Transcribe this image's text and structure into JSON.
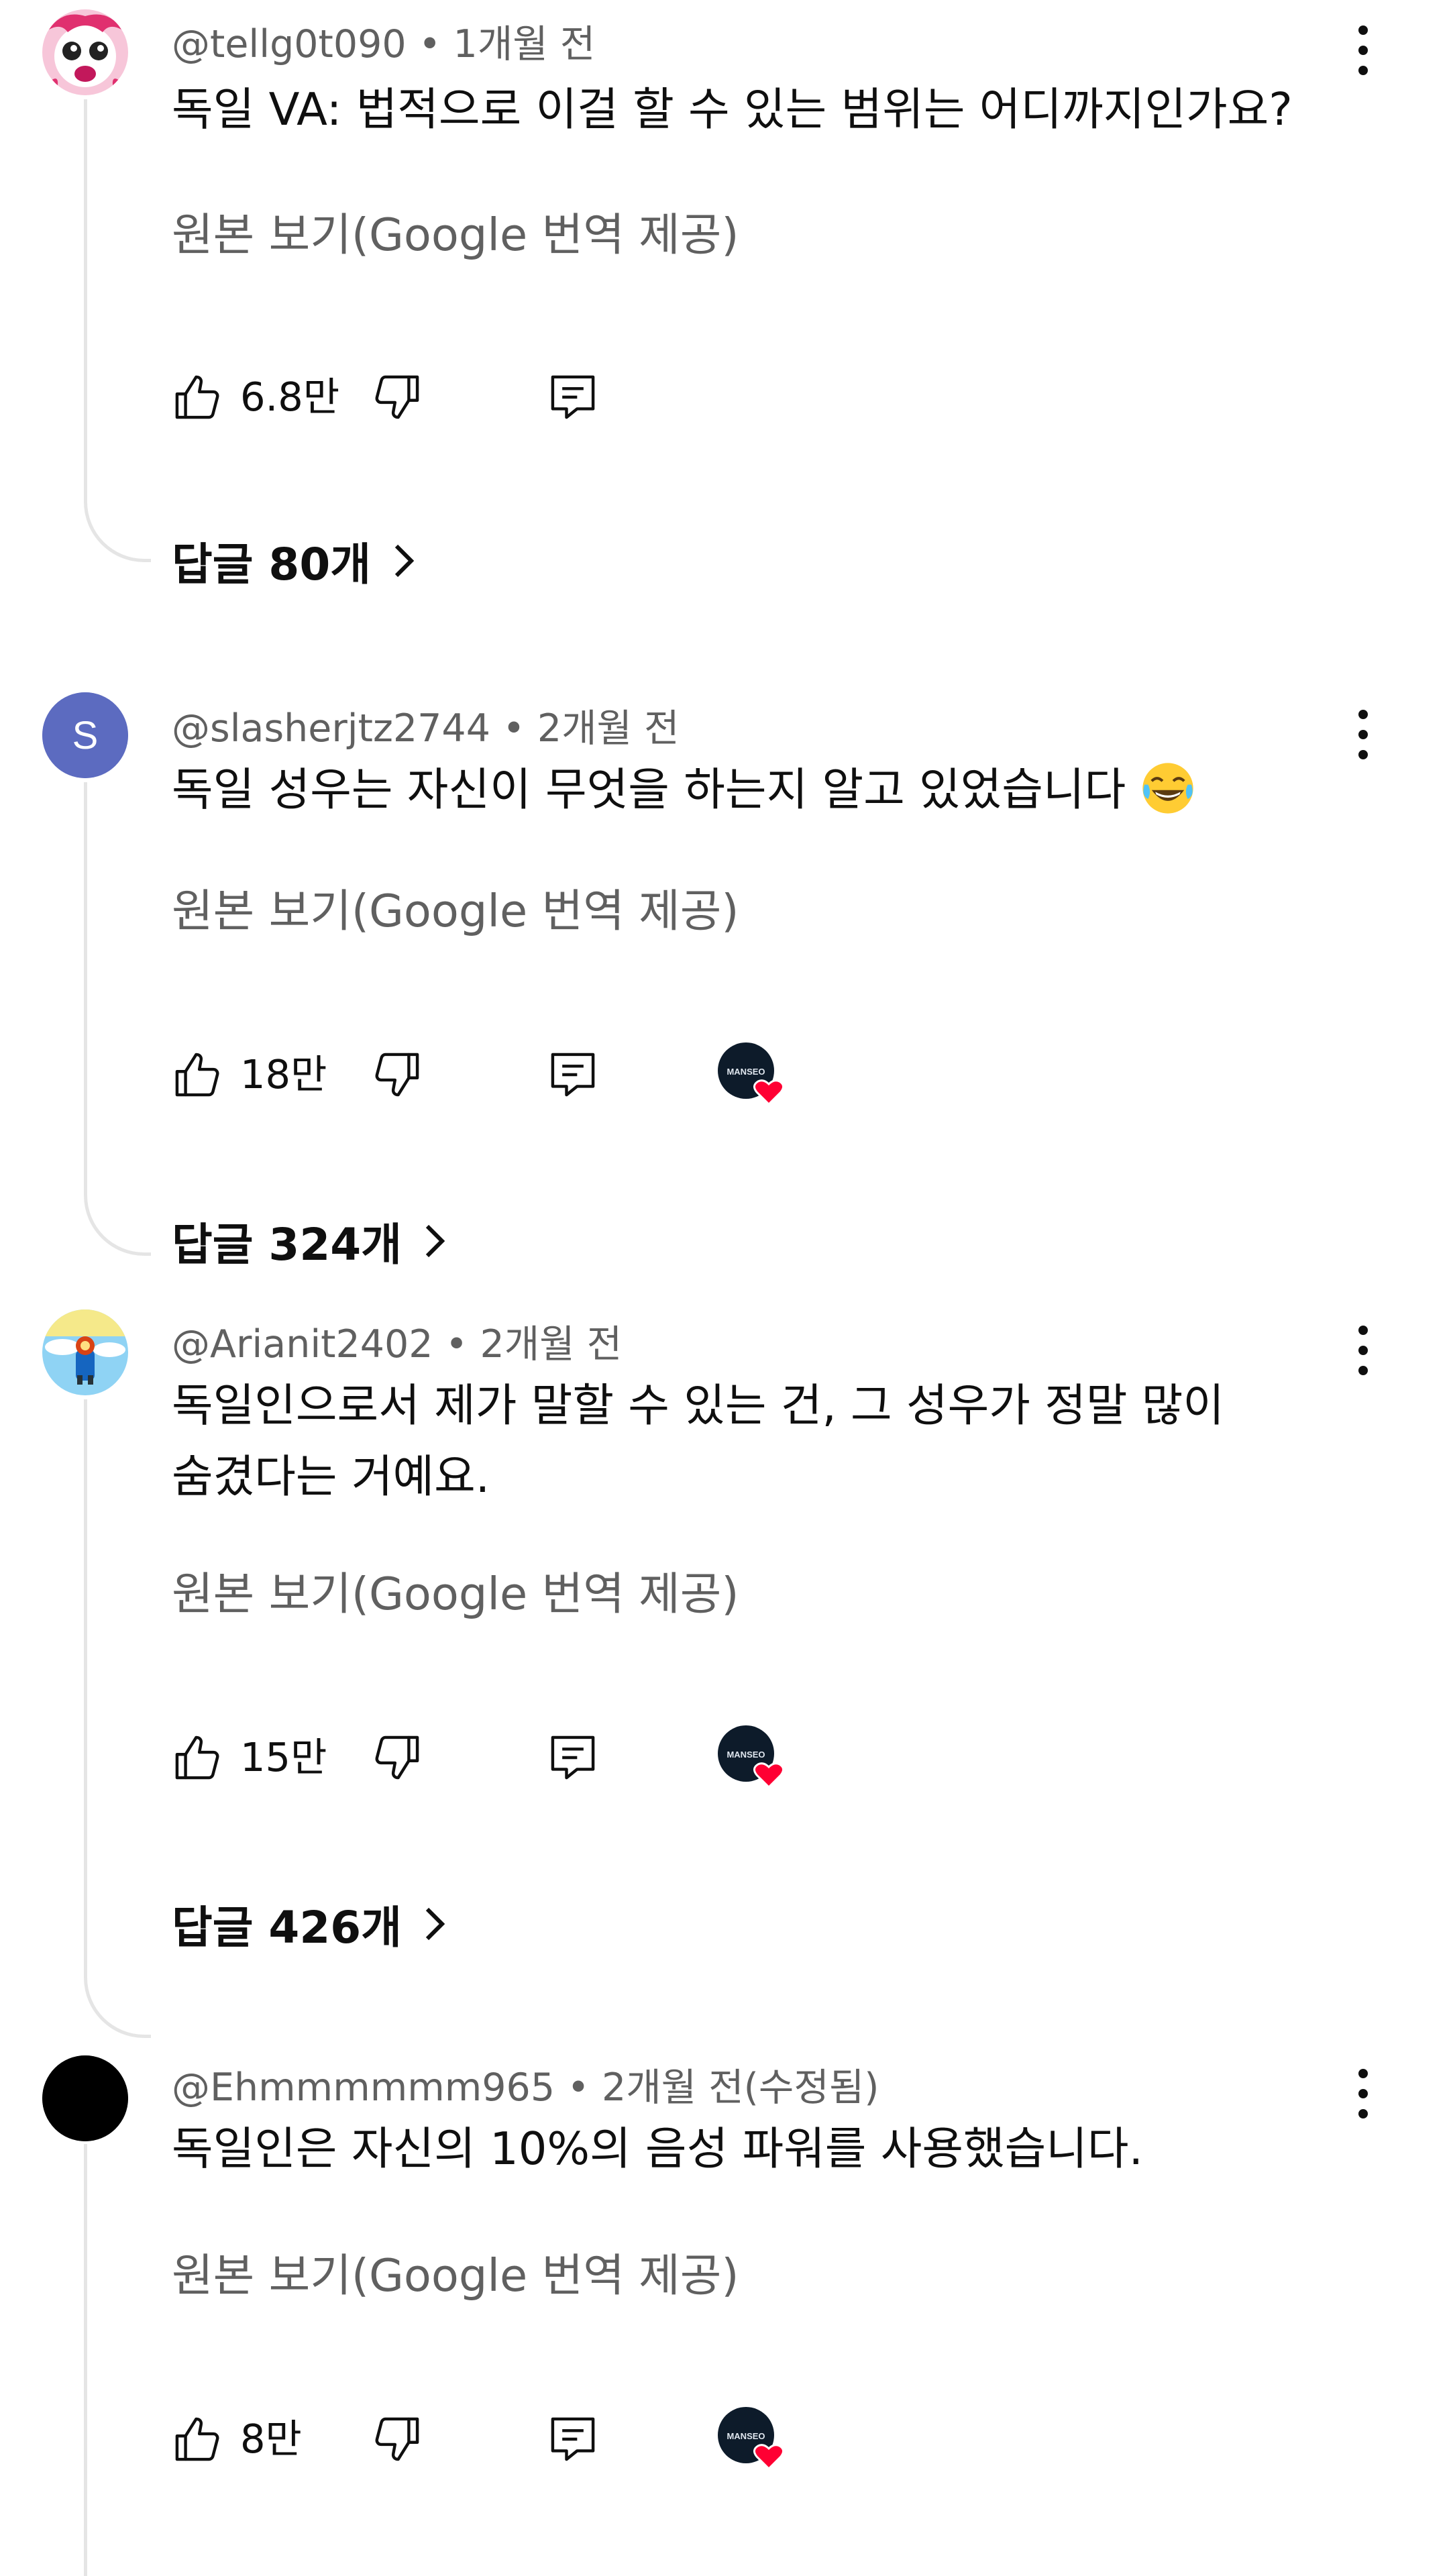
{
  "comments": [
    {
      "handle": "@tellg0t090",
      "time": "• 1개월 전",
      "text": "독일 VA: 법적으로 이걸 할 수 있는 범위는 어디까지인가요?",
      "translate_label": "원본 보기(Google 번역 제공)",
      "likes": "6.8만",
      "replies_label": "답글 80개",
      "creator_hearted": false,
      "avatar_icon": "pink-cartoon-avatar"
    },
    {
      "handle": "@slasherjtz2744",
      "time": "• 2개월 전",
      "text": "독일 성우는 자신이 무엇을 하는지 알고 있었습니다",
      "emoji": "laughing-tears-emoji",
      "translate_label": "원본 보기(Google 번역 제공)",
      "likes": "18만",
      "replies_label": "답글 324개",
      "creator_hearted": true,
      "avatar_letter": "S",
      "avatar_color": "#5c6bc0"
    },
    {
      "handle": "@Arianit2402",
      "time": "• 2개월 전",
      "text_line1": "독일인으로서 제가 말할 수 있는 건, 그 성우가 정말 많이",
      "text_line2": "숨겼다는 거예요.",
      "translate_label": "원본 보기(Google 번역 제공)",
      "likes": "15만",
      "replies_label": "답글 426개",
      "creator_hearted": true,
      "avatar_icon": "sky-character-avatar"
    },
    {
      "handle": "@Ehmmmmmm965",
      "time": "• 2개월 전(수정됨)",
      "text": "독일인은 자신의 10%의 음성 파워를 사용했습니다.",
      "translate_label": "원본 보기(Google 번역 제공)",
      "likes": "8만",
      "creator_hearted": true,
      "avatar_color": "#000000"
    }
  ],
  "creator_badge_text": "MANSEO",
  "colors": {
    "text_primary": "#0f0f0f",
    "text_secondary": "#606060",
    "thread_line": "#e5e5e5",
    "heart": "#ff0033"
  }
}
